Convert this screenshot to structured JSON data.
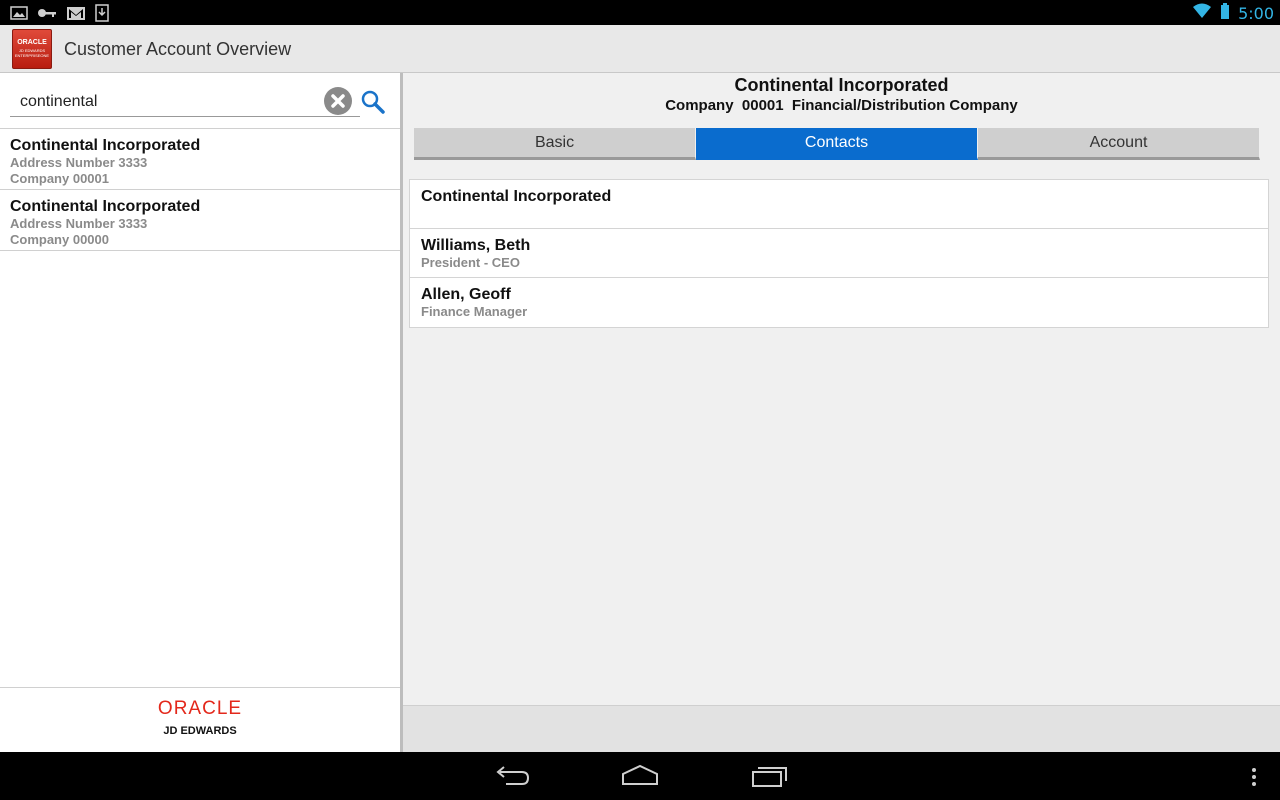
{
  "status_bar": {
    "time": "5:00",
    "icons": [
      "gallery-icon",
      "key-icon",
      "gmail-icon",
      "download-icon",
      "wifi-icon",
      "battery-icon"
    ]
  },
  "action_bar": {
    "logo_line1": "ORACLE",
    "logo_line2": "JD EDWARDS ENTERPRISEONE",
    "title": "Customer Account Overview"
  },
  "search": {
    "value": "continental"
  },
  "results": [
    {
      "title": "Continental Incorporated",
      "address": "Address Number 3333",
      "company": "Company 00001"
    },
    {
      "title": "Continental Incorporated",
      "address": "Address Number 3333",
      "company": "Company 00000"
    }
  ],
  "left_footer": {
    "oracle": "ORACLE",
    "jde": "JD EDWARDS"
  },
  "detail": {
    "name": "Continental Incorporated",
    "company_line": "Company  00001  Financial/Distribution Company",
    "tabs": [
      {
        "label": "Basic",
        "active": false
      },
      {
        "label": "Contacts",
        "active": true
      },
      {
        "label": "Account",
        "active": false
      }
    ],
    "contacts": [
      {
        "name": "Continental Incorporated",
        "role": ""
      },
      {
        "name": "Williams, Beth",
        "role": "President - CEO"
      },
      {
        "name": "Allen, Geoff",
        "role": "Finance Manager"
      }
    ]
  },
  "colors": {
    "accent": "#0a6cce",
    "oracle_red": "#e3281b",
    "clock": "#33b5e5"
  },
  "nav_bar": {
    "icons": [
      "back-icon",
      "home-icon",
      "recent-apps-icon",
      "overflow-menu-icon"
    ]
  }
}
